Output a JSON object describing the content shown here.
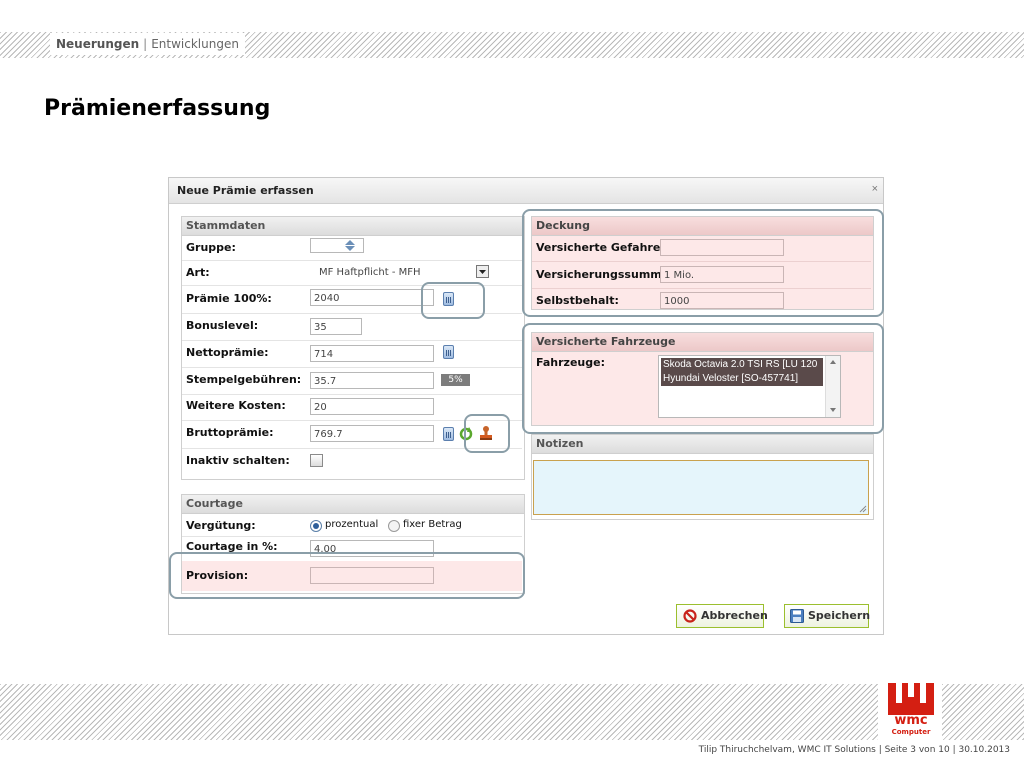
{
  "header": {
    "section": "Neuerungen",
    "separator": "|",
    "subsection": "Entwicklungen"
  },
  "page_title": "Prämienerfassung",
  "dialog": {
    "title": "Neue Prämie erfassen",
    "close": "×",
    "stammdaten": {
      "title": "Stammdaten",
      "gruppe_label": "Gruppe:",
      "art_label": "Art:",
      "art_value": "MF Haftpflicht - MFH",
      "praemie_label": "Prämie 100%:",
      "praemie_value": "2040",
      "bonus_label": "Bonuslevel:",
      "bonus_value": "35",
      "netto_label": "Nettoprämie:",
      "netto_value": "714",
      "stempel_label": "Stempelgebühren:",
      "stempel_value": "35.7",
      "stempel_badge": "5%",
      "weitere_label": "Weitere Kosten:",
      "weitere_value": "20",
      "brutto_label": "Bruttoprämie:",
      "brutto_value": "769.7",
      "inaktiv_label": "Inaktiv schalten:"
    },
    "courtage": {
      "title": "Courtage",
      "verguetung_label": "Vergütung:",
      "option_prozentual": "prozentual",
      "option_fixer": "fixer Betrag",
      "courtage_label": "Courtage in %:",
      "courtage_value": "4.00",
      "provision_label": "Provision:"
    },
    "deckung": {
      "title": "Deckung",
      "gefahren_label": "Versicherte Gefahren:",
      "summe_label": "Versicherungssumme:",
      "summe_value": "1 Mio.",
      "selbstbehalt_label": "Selbstbehalt:",
      "selbstbehalt_value": "1000"
    },
    "fahrzeuge": {
      "title": "Versicherte Fahrzeuge",
      "label": "Fahrzeuge:",
      "items": [
        "Skoda Octavia 2.0 TSI RS [LU 120",
        "Hyundai Veloster [SO-457741]"
      ]
    },
    "notizen": {
      "title": "Notizen"
    },
    "buttons": {
      "cancel": "Abbrechen",
      "save": "Speichern"
    }
  },
  "footer": {
    "text": "Tilip Thiruchchelvam, WMC IT Solutions  |  Seite 3 von 10  |  30.10.2013"
  },
  "logo": {
    "text": "wmc",
    "subtext": "Computer"
  },
  "colors": {
    "accent_red": "#d41f12",
    "button_border": "#9bbf2e",
    "panel_pink": "#fde8e8",
    "highlight_ring": "#8a9ea8",
    "notes_bg": "#e5f5fb"
  }
}
